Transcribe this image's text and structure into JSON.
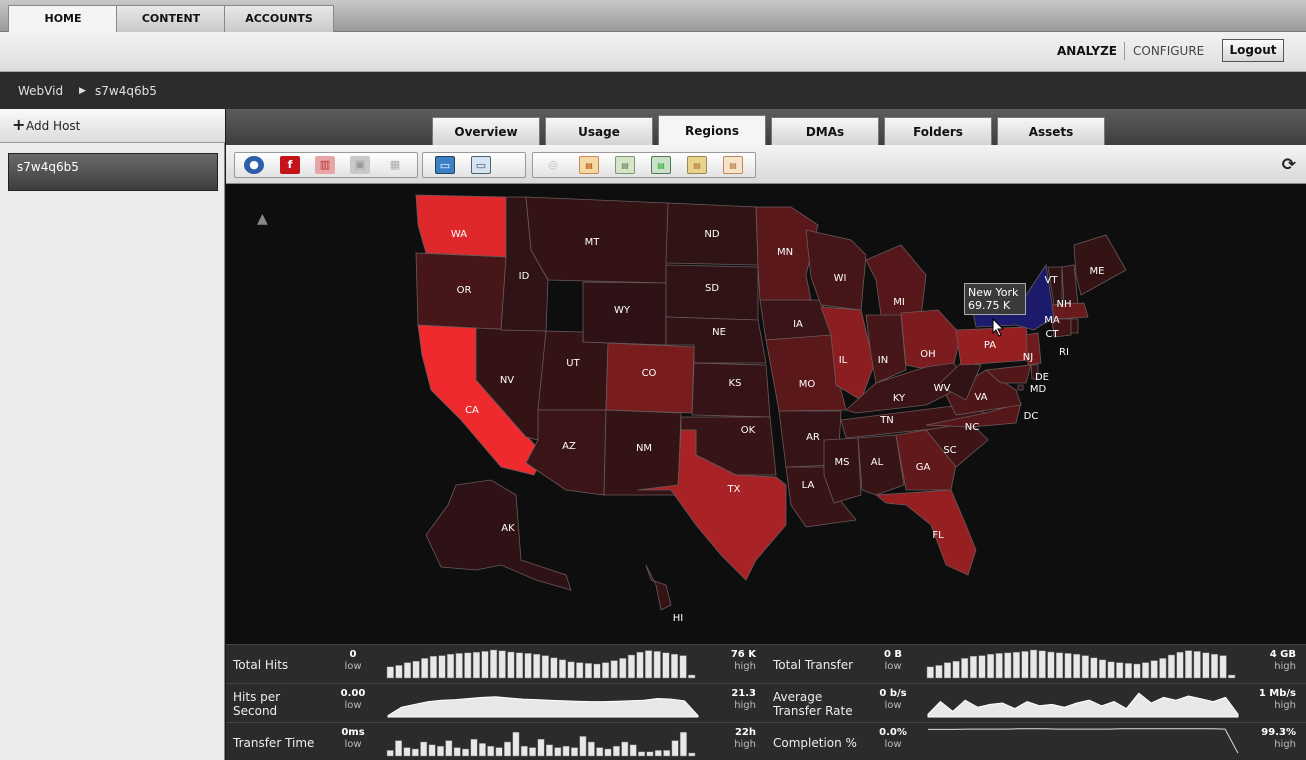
{
  "topnav": {
    "tabs": [
      "HOME",
      "CONTENT",
      "ACCOUNTS"
    ],
    "active": "HOME"
  },
  "header": {
    "analyze": "ANALYZE",
    "configure": "CONFIGURE",
    "logout": "Logout"
  },
  "breadcrumb": {
    "root": "WebVid",
    "separator": "▶",
    "current": "s7w4q6b5"
  },
  "sidebar": {
    "add_host": "Add Host",
    "hosts": [
      "s7w4q6b5"
    ]
  },
  "view_tabs": [
    "Overview",
    "Usage",
    "Regions",
    "DMAs",
    "Folders",
    "Assets"
  ],
  "active_view_tab": "Regions",
  "toolbar_icons": [
    "globe-icon",
    "flash-icon",
    "silverlight-icon",
    "apple-icon",
    "windows-icon",
    "picture-icon",
    "window-icon",
    "disc-icon",
    "calendar-day-icon",
    "calendar-week-icon",
    "calendar-month-icon",
    "calendar-year-icon",
    "calendar-range-icon",
    "refresh-icon"
  ],
  "map": {
    "colors": {
      "low": "#2a1214",
      "high": "#ee2a2e",
      "hover": "#1c1a6b"
    },
    "states": [
      {
        "code": "WA",
        "level": 0.92
      },
      {
        "code": "OR",
        "level": 0.15
      },
      {
        "code": "CA",
        "level": 1.0
      },
      {
        "code": "NV",
        "level": 0.05
      },
      {
        "code": "ID",
        "level": 0.03
      },
      {
        "code": "MT",
        "level": 0.05
      },
      {
        "code": "WY",
        "level": 0.02
      },
      {
        "code": "UT",
        "level": 0.05
      },
      {
        "code": "AZ",
        "level": 0.08
      },
      {
        "code": "CO",
        "level": 0.4
      },
      {
        "code": "NM",
        "level": 0.05
      },
      {
        "code": "ND",
        "level": 0.03
      },
      {
        "code": "SD",
        "level": 0.03
      },
      {
        "code": "NE",
        "level": 0.04
      },
      {
        "code": "KS",
        "level": 0.06
      },
      {
        "code": "OK",
        "level": 0.07
      },
      {
        "code": "TX",
        "level": 0.65
      },
      {
        "code": "MN",
        "level": 0.25
      },
      {
        "code": "IA",
        "level": 0.08
      },
      {
        "code": "MO",
        "level": 0.25
      },
      {
        "code": "AR",
        "level": 0.06
      },
      {
        "code": "LA",
        "level": 0.07
      },
      {
        "code": "WI",
        "level": 0.14
      },
      {
        "code": "IL",
        "level": 0.5
      },
      {
        "code": "MI",
        "level": 0.22
      },
      {
        "code": "IN",
        "level": 0.15
      },
      {
        "code": "OH",
        "level": 0.42
      },
      {
        "code": "KY",
        "level": 0.08
      },
      {
        "code": "TN",
        "level": 0.1
      },
      {
        "code": "MS",
        "level": 0.05
      },
      {
        "code": "AL",
        "level": 0.07
      },
      {
        "code": "GA",
        "level": 0.28
      },
      {
        "code": "FL",
        "level": 0.55
      },
      {
        "code": "SC",
        "level": 0.1
      },
      {
        "code": "NC",
        "level": 0.22
      },
      {
        "code": "VA",
        "level": 0.18
      },
      {
        "code": "WV",
        "level": 0.04
      },
      {
        "code": "PA",
        "level": 0.55
      },
      {
        "code": "NY",
        "level": 0.0,
        "hover": true
      },
      {
        "code": "VT",
        "level": 0.04
      },
      {
        "code": "NH",
        "level": 0.06
      },
      {
        "code": "ME",
        "level": 0.05
      },
      {
        "code": "MA",
        "level": 0.32
      },
      {
        "code": "CT",
        "level": 0.12
      },
      {
        "code": "RI",
        "level": 0.05
      },
      {
        "code": "NJ",
        "level": 0.35
      },
      {
        "code": "DE",
        "level": 0.05
      },
      {
        "code": "MD",
        "level": 0.2
      },
      {
        "code": "DC",
        "level": 0.05
      },
      {
        "code": "AK",
        "level": 0.02
      },
      {
        "code": "HI",
        "level": 0.05
      }
    ],
    "tooltip": {
      "name": "New York",
      "value": "69.75 K"
    }
  },
  "metrics": [
    {
      "name": "Total Hits",
      "low_value": "0",
      "low_label": "low",
      "high_value": "76 K",
      "high_label": "high",
      "kind": "bars",
      "series": [
        0.4,
        0.45,
        0.55,
        0.6,
        0.7,
        0.78,
        0.8,
        0.85,
        0.88,
        0.9,
        0.92,
        0.95,
        1.0,
        0.97,
        0.93,
        0.9,
        0.88,
        0.85,
        0.8,
        0.72,
        0.65,
        0.58,
        0.55,
        0.52,
        0.5,
        0.55,
        0.62,
        0.7,
        0.82,
        0.92,
        0.98,
        0.95,
        0.9,
        0.85,
        0.8,
        0.1
      ]
    },
    {
      "name": "Total Transfer",
      "low_value": "0 B",
      "low_label": "low",
      "high_value": "4 GB",
      "high_label": "high",
      "kind": "bars",
      "series": [
        0.4,
        0.45,
        0.55,
        0.6,
        0.7,
        0.78,
        0.8,
        0.85,
        0.88,
        0.9,
        0.92,
        0.95,
        1.0,
        0.97,
        0.93,
        0.9,
        0.88,
        0.85,
        0.8,
        0.72,
        0.65,
        0.58,
        0.55,
        0.52,
        0.5,
        0.55,
        0.62,
        0.7,
        0.82,
        0.92,
        0.98,
        0.95,
        0.9,
        0.85,
        0.8,
        0.1
      ]
    },
    {
      "name": "Hits per\nSecond",
      "low_value": "0.00",
      "low_label": "low",
      "high_value": "21.3",
      "high_label": "high",
      "kind": "area",
      "series": [
        0.05,
        0.35,
        0.45,
        0.55,
        0.6,
        0.62,
        0.66,
        0.7,
        0.72,
        0.68,
        0.64,
        0.62,
        0.6,
        0.58,
        0.56,
        0.55,
        0.55,
        0.56,
        0.58,
        0.6,
        0.66,
        0.64,
        0.58,
        0.05
      ]
    },
    {
      "name": "Average\nTransfer Rate",
      "low_value": "0 b/s",
      "low_label": "low",
      "high_value": "1 Mb/s",
      "high_label": "high",
      "kind": "area",
      "series": [
        0.1,
        0.55,
        0.2,
        0.6,
        0.35,
        0.45,
        0.5,
        0.3,
        0.55,
        0.4,
        0.45,
        0.35,
        0.5,
        0.6,
        0.4,
        0.55,
        0.3,
        0.85,
        0.5,
        0.7,
        0.6,
        0.75,
        0.65,
        0.55,
        0.7,
        0.1
      ]
    },
    {
      "name": "Transfer Time",
      "low_value": "0ms",
      "low_label": "low",
      "high_value": "22h",
      "high_label": "high",
      "kind": "bars",
      "series": [
        0.2,
        0.55,
        0.3,
        0.25,
        0.5,
        0.4,
        0.35,
        0.55,
        0.3,
        0.25,
        0.6,
        0.45,
        0.35,
        0.3,
        0.5,
        0.85,
        0.35,
        0.3,
        0.6,
        0.4,
        0.3,
        0.35,
        0.3,
        0.7,
        0.5,
        0.3,
        0.25,
        0.35,
        0.5,
        0.4,
        0.15,
        0.15,
        0.2,
        0.2,
        0.55,
        0.85,
        0.1
      ]
    },
    {
      "name": "Completion %",
      "low_value": "0.0%",
      "low_label": "low",
      "high_value": "99.3%",
      "high_label": "high",
      "kind": "line",
      "series": [
        0.95,
        0.95,
        0.95,
        0.96,
        0.96,
        0.96,
        0.96,
        0.97,
        0.97,
        0.97,
        0.96,
        0.96,
        0.96,
        0.96,
        0.96,
        0.97,
        0.97,
        0.97,
        0.97,
        0.97,
        0.97,
        0.97,
        0.97,
        0.96,
        0.1
      ]
    }
  ]
}
